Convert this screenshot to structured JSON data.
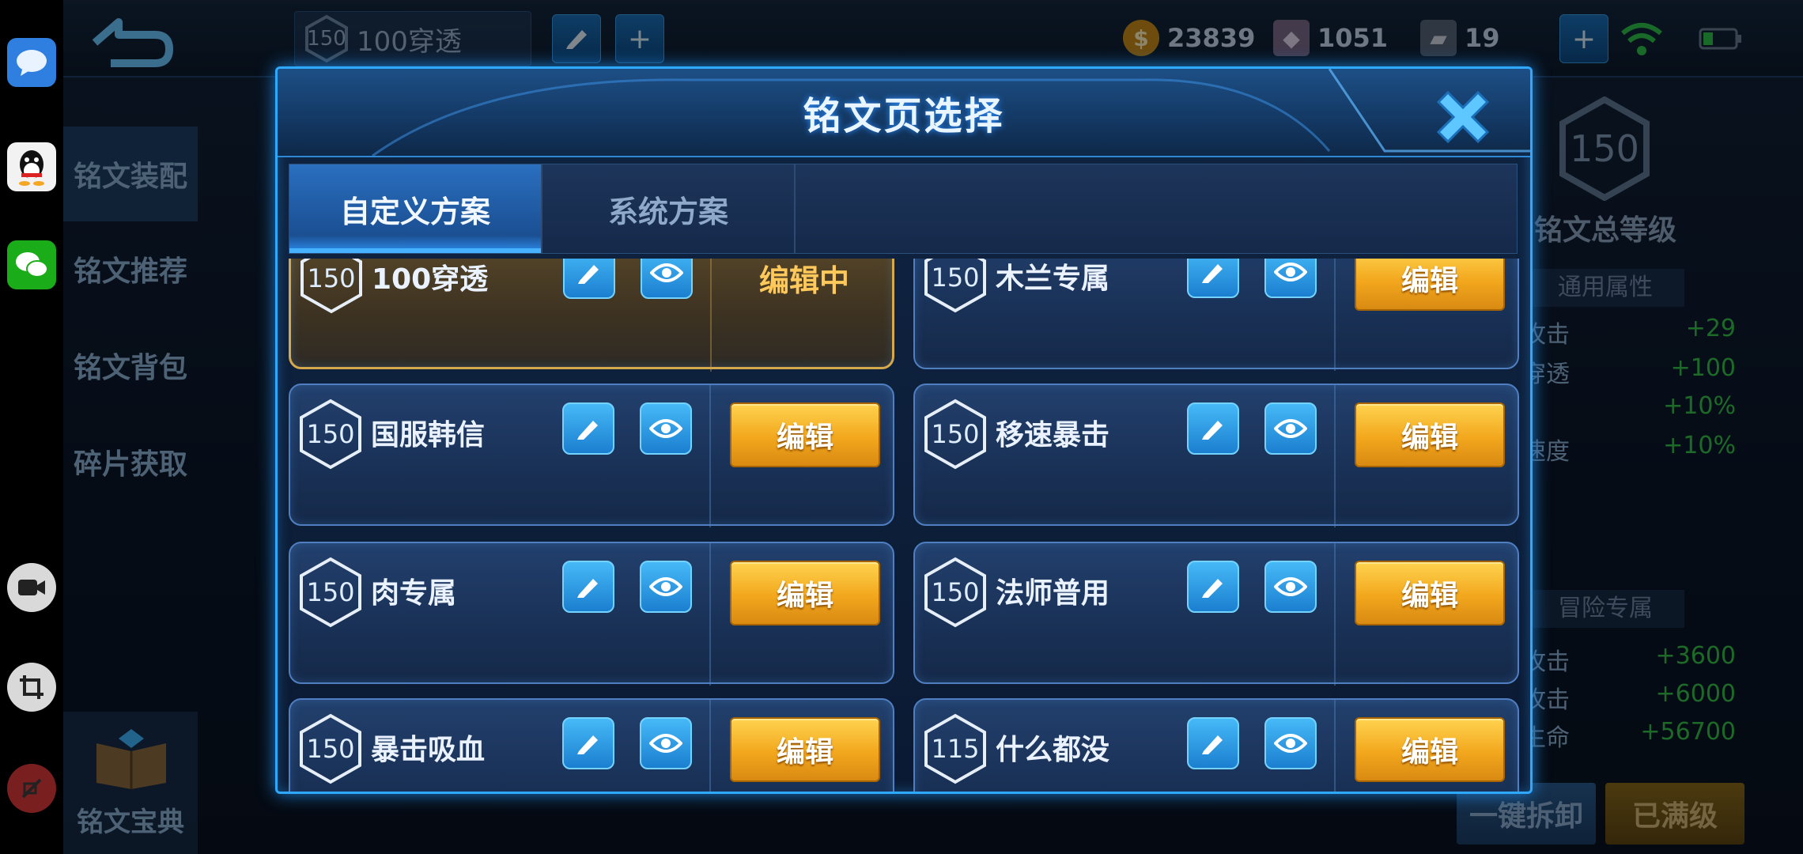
{
  "top": {
    "current_plan_level": "150",
    "current_plan_name": "100穿透",
    "resources": [
      {
        "icon": "gold-coin-icon",
        "value": "23839"
      },
      {
        "icon": "diamond-icon",
        "value": "1051"
      },
      {
        "icon": "rune-fragment-icon",
        "value": "19"
      }
    ]
  },
  "left_nav": [
    "铭文装配",
    "铭文推荐",
    "铭文背包",
    "碎片获取"
  ],
  "bottom_left_label": "铭文宝典",
  "right_panel": {
    "total_level": "150",
    "total_level_label": "铭文总等级",
    "section_general": "通用属性",
    "general_stats": [
      {
        "k": "攻击",
        "v": "+29"
      },
      {
        "k": "穿透",
        "v": "+100"
      },
      {
        "k": "",
        "v": "+10%"
      },
      {
        "k": "速度",
        "v": "+10%"
      }
    ],
    "section_adventure": "冒险专属",
    "adventure_stats": [
      {
        "k": "攻击",
        "v": "+3600"
      },
      {
        "k": "攻击",
        "v": "+6000"
      },
      {
        "k": "生命",
        "v": "+56700"
      }
    ]
  },
  "bottom_buttons": {
    "unequip": "一键拆卸",
    "maxed": "已满级"
  },
  "modal": {
    "title": "铭文页选择",
    "tabs": [
      {
        "label": "自定义方案",
        "active": true
      },
      {
        "label": "系统方案",
        "active": false
      }
    ],
    "edit_label": "编辑",
    "editing_label": "编辑中",
    "pages": [
      {
        "level": "150",
        "name": "100穿透",
        "editing": true
      },
      {
        "level": "150",
        "name": "木兰专属",
        "editing": false
      },
      {
        "level": "150",
        "name": "国服韩信",
        "editing": false
      },
      {
        "level": "150",
        "name": "移速暴击",
        "editing": false
      },
      {
        "level": "150",
        "name": "肉专属",
        "editing": false
      },
      {
        "level": "150",
        "name": "法师普用",
        "editing": false
      },
      {
        "level": "150",
        "name": "暴击吸血",
        "editing": false
      },
      {
        "level": "115",
        "name": "什么都没",
        "editing": false
      }
    ]
  },
  "colors": {
    "accent": "#2fa8ff",
    "edit_gold": "#f2a71d",
    "stat_green": "#35c24a"
  }
}
